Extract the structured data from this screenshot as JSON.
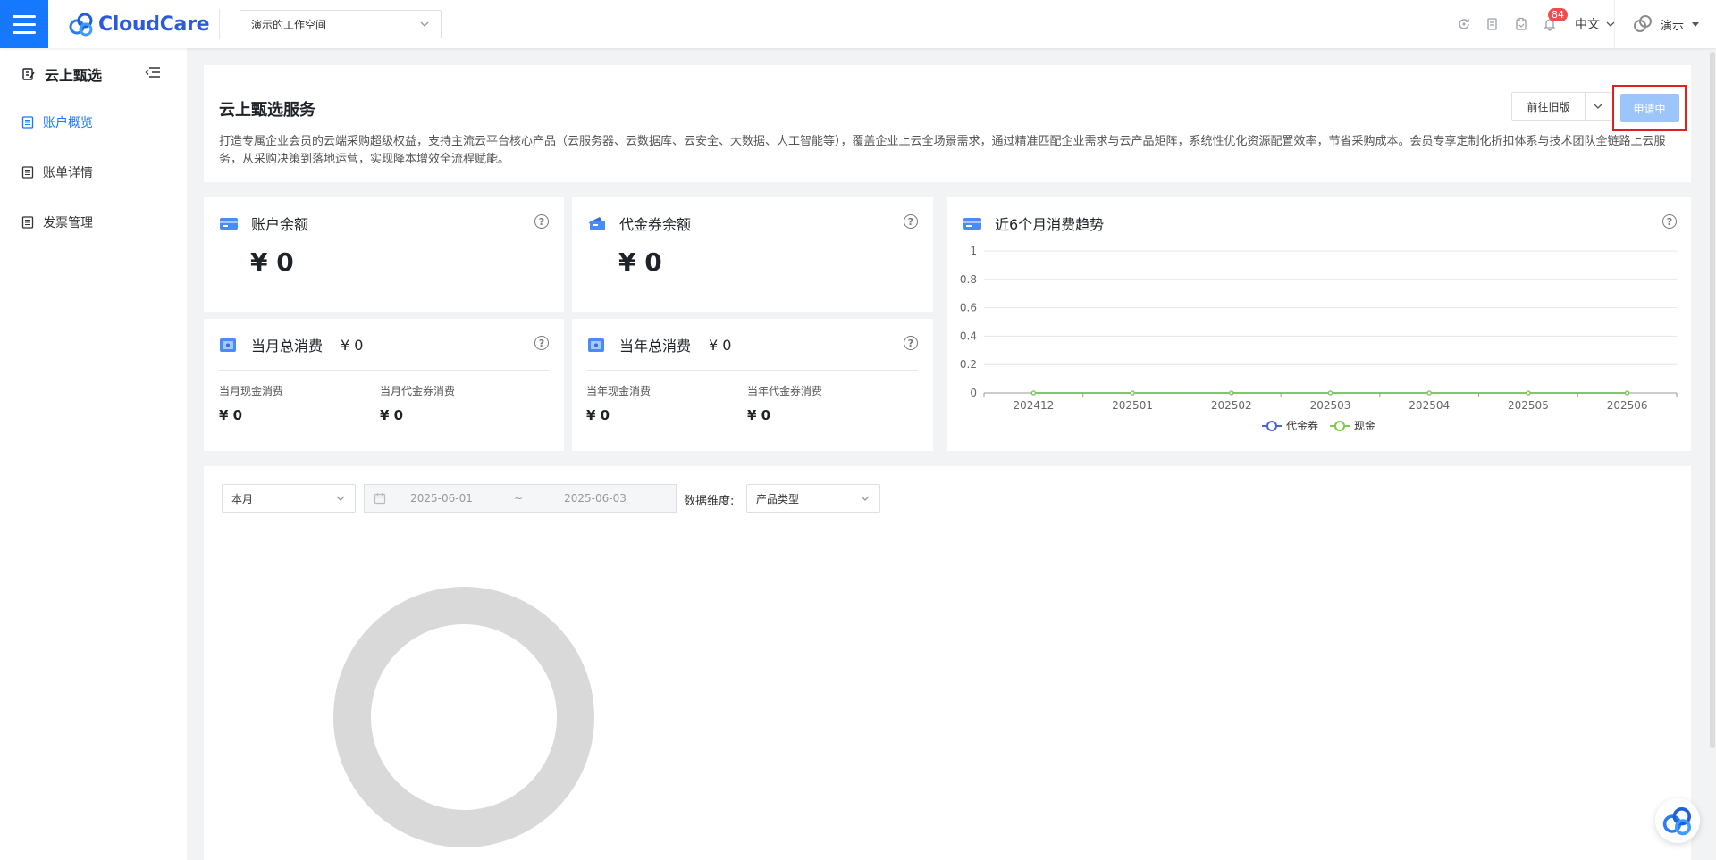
{
  "header": {
    "logo_text": "CloudCare",
    "workspace": "演示的工作空间",
    "notification_count": "84",
    "language": "中文",
    "user": "演示"
  },
  "sidebar": {
    "title": "云上甄选",
    "items": [
      {
        "label": "账户概览",
        "active": true
      },
      {
        "label": "账单详情",
        "active": false
      },
      {
        "label": "发票管理",
        "active": false
      }
    ]
  },
  "intro": {
    "title": "云上甄选服务",
    "description": "打造专属企业会员的云端采购超级权益，支持主流云平台核心产品（云服务器、云数据库、云安全、大数据、人工智能等），覆盖企业上云全场景需求，通过精准匹配企业需求与云产品矩阵，系统性优化资源配置效率，节省采购成本。会员专享定制化折扣体系与技术团队全链路上云服务，从采购决策到落地运营，实现降本增效全流程赋能。",
    "old_version_label": "前往旧版",
    "apply_label": "申请中"
  },
  "cards": {
    "account_balance": {
      "title": "账户余额",
      "value": "¥ 0"
    },
    "voucher_balance": {
      "title": "代金券余额",
      "value": "¥ 0"
    },
    "month_total": {
      "title": "当月总消费",
      "value": "¥ 0",
      "cash_label": "当月现金消费",
      "cash_value": "¥ 0",
      "voucher_label": "当月代金券消费",
      "voucher_value": "¥ 0"
    },
    "year_total": {
      "title": "当年总消费",
      "value": "¥ 0",
      "cash_label": "当年现金消费",
      "cash_value": "¥ 0",
      "voucher_label": "当年代金券消费",
      "voucher_value": "¥ 0"
    }
  },
  "chart_data": {
    "type": "line",
    "title": "近6个月消费趋势",
    "categories": [
      "202412",
      "202501",
      "202502",
      "202503",
      "202504",
      "202505",
      "202506"
    ],
    "series": [
      {
        "name": "代金券",
        "values": [
          0,
          0,
          0,
          0,
          0,
          0,
          0
        ],
        "color": "#4b63d9"
      },
      {
        "name": "现金",
        "values": [
          0,
          0,
          0,
          0,
          0,
          0,
          0
        ],
        "color": "#7ccb4a"
      }
    ],
    "ylim": [
      0,
      1
    ],
    "yticks": [
      "0",
      "0.2",
      "0.4",
      "0.6",
      "0.8",
      "1"
    ],
    "grid": true,
    "legend": "bottom-center"
  },
  "filters": {
    "period": "本月",
    "date_start": "2025-06-01",
    "date_sep": "~",
    "date_end": "2025-06-03",
    "dimension_label": "数据维度:",
    "dimension": "产品类型"
  },
  "colors": {
    "primary": "#1677ff",
    "donut_empty": "#d9d9d9"
  }
}
